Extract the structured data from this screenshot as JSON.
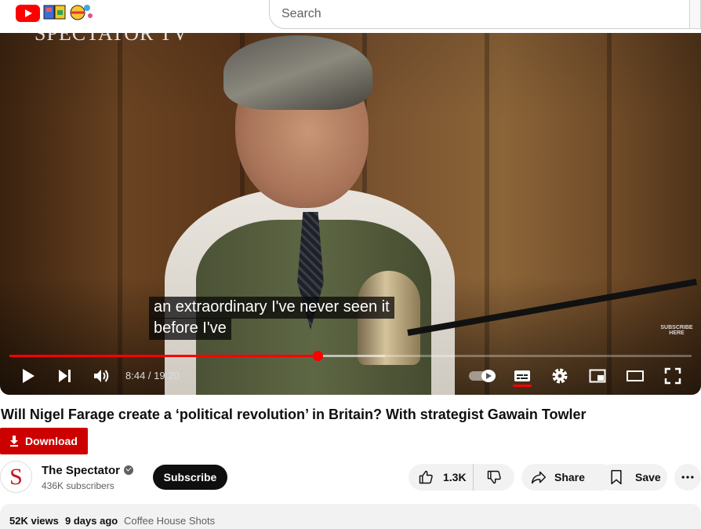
{
  "masthead": {
    "search_placeholder": "Search"
  },
  "player": {
    "watermark": "SPECTATOR TV",
    "subscribe_overlay": "SUBSCRIBE HERE",
    "caption_lines": [
      "an extraordinary I've never seen it",
      "before I've"
    ],
    "current_time": "8:44",
    "separator": " / ",
    "duration": "19:20",
    "progress_fraction": 0.452,
    "buffered_fraction": 0.55,
    "autoplay_on": true
  },
  "video": {
    "title": "Will Nigel Farage create a ‘political revolution’ in Britain? With strategist Gawain Towler",
    "download_label": "Download"
  },
  "channel": {
    "avatar_letter": "S",
    "name": "The Spectator",
    "subscribers": "436K subscribers",
    "subscribe_label": "Subscribe"
  },
  "actions": {
    "like_count": "1.3K",
    "share_label": "Share",
    "save_label": "Save"
  },
  "description": {
    "views": "52K views",
    "uploaded": "9 days ago",
    "tag": "Coffee House Shots"
  },
  "colors": {
    "brand_red": "#ff0000",
    "download_red": "#cc0000"
  }
}
